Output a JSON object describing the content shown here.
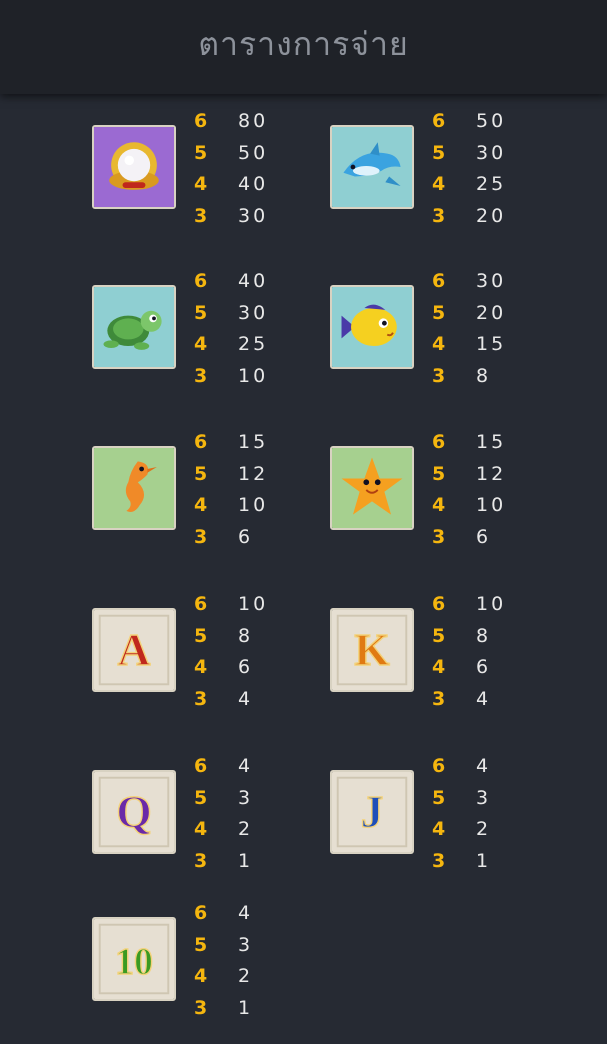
{
  "header": {
    "title": "ตารางการจ่าย"
  },
  "symbols": [
    {
      "icon": "pearl-icon",
      "bg": "#9b6ad2",
      "pays": [
        {
          "count": "6",
          "value": "80"
        },
        {
          "count": "5",
          "value": "50"
        },
        {
          "count": "4",
          "value": "40"
        },
        {
          "count": "3",
          "value": "30"
        }
      ]
    },
    {
      "icon": "dolphin-icon",
      "bg": "#8fcfd2",
      "pays": [
        {
          "count": "6",
          "value": "50"
        },
        {
          "count": "5",
          "value": "30"
        },
        {
          "count": "4",
          "value": "25"
        },
        {
          "count": "3",
          "value": "20"
        }
      ]
    },
    {
      "icon": "turtle-icon",
      "bg": "#8fcfd2",
      "pays": [
        {
          "count": "6",
          "value": "40"
        },
        {
          "count": "5",
          "value": "30"
        },
        {
          "count": "4",
          "value": "25"
        },
        {
          "count": "3",
          "value": "10"
        }
      ]
    },
    {
      "icon": "yellow-fish-icon",
      "bg": "#8fcfd2",
      "pays": [
        {
          "count": "6",
          "value": "30"
        },
        {
          "count": "5",
          "value": "20"
        },
        {
          "count": "4",
          "value": "15"
        },
        {
          "count": "3",
          "value": "8"
        }
      ]
    },
    {
      "icon": "seahorse-icon",
      "bg": "#a6d08f",
      "pays": [
        {
          "count": "6",
          "value": "15"
        },
        {
          "count": "5",
          "value": "12"
        },
        {
          "count": "4",
          "value": "10"
        },
        {
          "count": "3",
          "value": "6"
        }
      ]
    },
    {
      "icon": "starfish-icon",
      "bg": "#a6d08f",
      "pays": [
        {
          "count": "6",
          "value": "15"
        },
        {
          "count": "5",
          "value": "12"
        },
        {
          "count": "4",
          "value": "10"
        },
        {
          "count": "3",
          "value": "6"
        }
      ]
    },
    {
      "icon": "letter-a-icon",
      "letter": "A",
      "letter_color": "#c0281c",
      "bg": "#e6dfd2",
      "pays": [
        {
          "count": "6",
          "value": "10"
        },
        {
          "count": "5",
          "value": "8"
        },
        {
          "count": "4",
          "value": "6"
        },
        {
          "count": "3",
          "value": "4"
        }
      ]
    },
    {
      "icon": "letter-k-icon",
      "letter": "K",
      "letter_color": "#e07a12",
      "bg": "#e6dfd2",
      "pays": [
        {
          "count": "6",
          "value": "10"
        },
        {
          "count": "5",
          "value": "8"
        },
        {
          "count": "4",
          "value": "6"
        },
        {
          "count": "3",
          "value": "4"
        }
      ]
    },
    {
      "icon": "letter-q-icon",
      "letter": "Q",
      "letter_color": "#6a2aa8",
      "bg": "#e6dfd2",
      "pays": [
        {
          "count": "6",
          "value": "4"
        },
        {
          "count": "5",
          "value": "3"
        },
        {
          "count": "4",
          "value": "2"
        },
        {
          "count": "3",
          "value": "1"
        }
      ]
    },
    {
      "icon": "letter-j-icon",
      "letter": "J",
      "letter_color": "#1f4fb8",
      "bg": "#e6dfd2",
      "pays": [
        {
          "count": "6",
          "value": "4"
        },
        {
          "count": "5",
          "value": "3"
        },
        {
          "count": "4",
          "value": "2"
        },
        {
          "count": "3",
          "value": "1"
        }
      ]
    },
    {
      "icon": "number-10-icon",
      "letter": "10",
      "letter_color": "#3a9a22",
      "bg": "#e6dfd2",
      "pays": [
        {
          "count": "6",
          "value": "4"
        },
        {
          "count": "5",
          "value": "3"
        },
        {
          "count": "4",
          "value": "2"
        },
        {
          "count": "3",
          "value": "1"
        }
      ]
    }
  ]
}
